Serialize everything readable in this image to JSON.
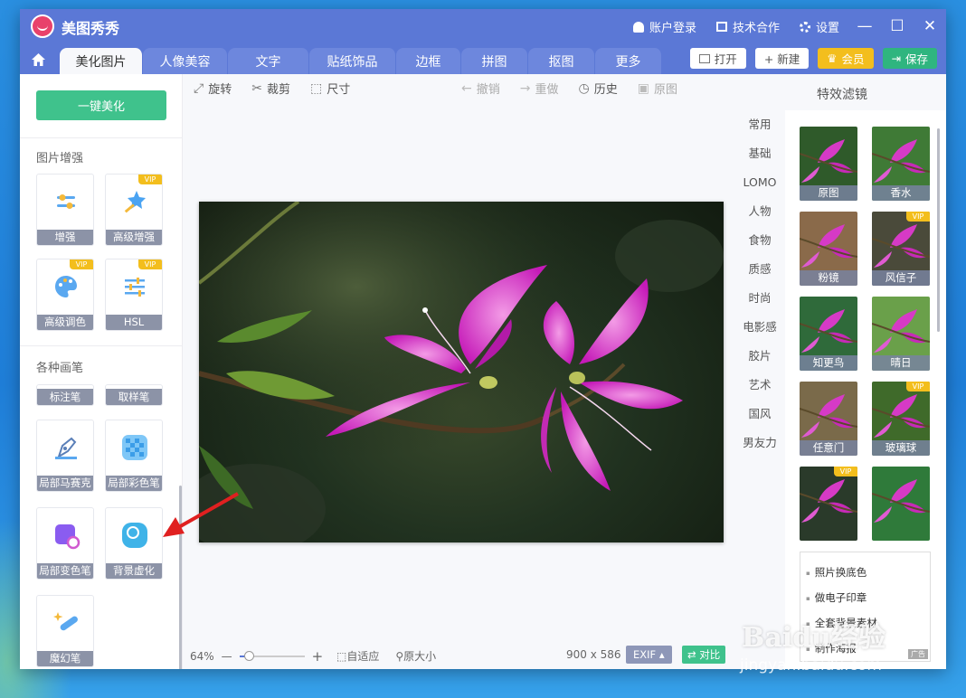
{
  "app": {
    "title": "美图秀秀"
  },
  "title_actions": {
    "login": "账户登录",
    "cooperate": "技术合作",
    "settings": "设置"
  },
  "window_controls": {
    "minimize": "—",
    "maximize": "☐",
    "close": "✕"
  },
  "tabs": [
    "美化图片",
    "人像美容",
    "文字",
    "贴纸饰品",
    "边框",
    "拼图",
    "抠图",
    "更多"
  ],
  "top_buttons": {
    "open": "打开",
    "new": "+ 新建",
    "vip": "会员",
    "save": "保存"
  },
  "left": {
    "one_click": "一键美化",
    "enhance_title": "图片增强",
    "enhance_tools": [
      {
        "label": "增强",
        "vip": ""
      },
      {
        "label": "高级增强",
        "vip": "VIP"
      },
      {
        "label": "高级调色",
        "vip": "VIP"
      },
      {
        "label": "HSL",
        "vip": "VIP"
      }
    ],
    "brush_title": "各种画笔",
    "brush_tools": [
      {
        "label": "标注笔"
      },
      {
        "label": "取样笔"
      },
      {
        "label": "局部马赛克"
      },
      {
        "label": "局部彩色笔"
      },
      {
        "label": "局部变色笔"
      },
      {
        "label": "背景虚化"
      },
      {
        "label": "魔幻笔"
      }
    ]
  },
  "edit_tools": {
    "rotate": "旋转",
    "crop": "裁剪",
    "size": "尺寸",
    "undo": "撤销",
    "redo": "重做",
    "history": "历史",
    "original": "原图"
  },
  "bottom": {
    "zoom": "64%",
    "zoom_level": 0.15,
    "fit": "自适应",
    "actual": "原大小",
    "dimensions": "900 x 586",
    "exif": "EXIF",
    "compare": "对比"
  },
  "right": {
    "title": "特效滤镜",
    "categories": [
      "常用",
      "基础",
      "LOMO",
      "人物",
      "食物",
      "质感",
      "时尚",
      "电影感",
      "胶片",
      "艺术",
      "国风",
      "男友力"
    ],
    "filters": [
      {
        "label": "原图",
        "vip": ""
      },
      {
        "label": "香水",
        "vip": ""
      },
      {
        "label": "粉镜",
        "vip": ""
      },
      {
        "label": "风信子",
        "vip": "VIP"
      },
      {
        "label": "知更鸟",
        "vip": ""
      },
      {
        "label": "晴日",
        "vip": ""
      },
      {
        "label": "任意门",
        "vip": ""
      },
      {
        "label": "玻璃球",
        "vip": "VIP"
      },
      {
        "label": "",
        "vip": "VIP"
      },
      {
        "label": "",
        "vip": ""
      }
    ],
    "ad_items": [
      "照片换底色",
      "做电子印章",
      "全套背景素材",
      "制作海报"
    ],
    "ad_tag": "广告"
  },
  "watermark": {
    "line1": "Baidu经验",
    "line2": "jingyan.baidu.com"
  },
  "colors": {
    "titlebar": "#5b78d6",
    "accent_green": "#3fc28c",
    "vip_gold": "#f3be1d",
    "arrow_red": "#e02020"
  }
}
